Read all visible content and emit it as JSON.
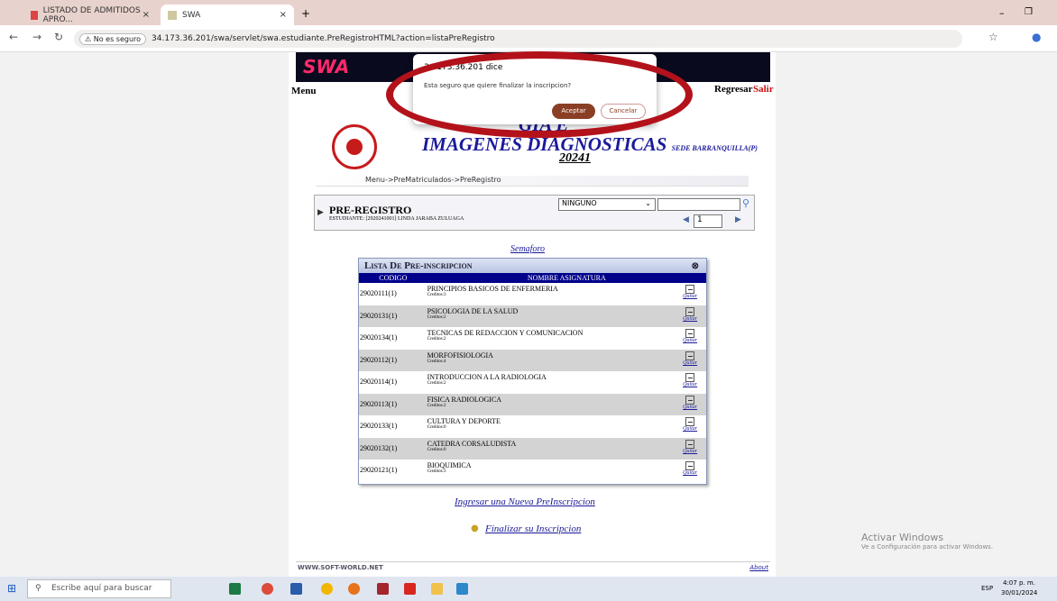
{
  "browser": {
    "tabs": [
      {
        "label": "LISTADO DE ADMITIDOS APRO...",
        "close": "×"
      },
      {
        "label": "SWA",
        "close": "×"
      }
    ],
    "new_tab": "+",
    "security_badge": "No es seguro",
    "url": "34.173.36.201/swa/servlet/swa.estudiante.PreRegistroHTML?action=listaPreRegistro",
    "window_controls": [
      "–",
      "❐"
    ]
  },
  "page": {
    "menu_label": "Menu",
    "regresar": "Regresar",
    "salir": "Salir",
    "title_line1": "GÍA E",
    "title_line2": "IMAGENES DIAGNOSTICAS",
    "sede": "SEDE BARRANQUILLA(P)",
    "period": "20241",
    "breadcrumb": "Menu->PreMatriculados->PreRegistro",
    "prereg_title": "PRE-REGISTRO",
    "student": "ESTUDIANTE: [2920241001] LINDA JARABA ZULUAGA",
    "filter_value": "NINGUNO",
    "page_number": "1",
    "semaforo": "Semaforo",
    "list_title": "Lista De Pre-inscripcion",
    "col_code": "CODIGO",
    "col_name": "NOMBRE ASIGNATURA",
    "rows": [
      {
        "code": "29020111(1)",
        "name": "PRINCIPIOS BASICOS DE ENFERMERIA",
        "credits": "Creditos:3",
        "action": "Quitar"
      },
      {
        "code": "29020131(1)",
        "name": "PSICOLOGIA DE LA SALUD",
        "credits": "Creditos:2",
        "action": "Quitar"
      },
      {
        "code": "29020134(1)",
        "name": "TECNICAS DE REDACCION Y COMUNICACION",
        "credits": "Creditos:2",
        "action": "Quitar"
      },
      {
        "code": "29020112(1)",
        "name": "MORFOFISIOLOGIA",
        "credits": "Creditos:4",
        "action": "Quitar"
      },
      {
        "code": "29020114(1)",
        "name": "INTRODUCCION A LA RADIOLOGIA",
        "credits": "Creditos:2",
        "action": "Quitar"
      },
      {
        "code": "29020113(1)",
        "name": "FISICA RADIOLOGICA",
        "credits": "Creditos:2",
        "action": "Quitar"
      },
      {
        "code": "29020133(1)",
        "name": "CULTURA Y DEPORTE",
        "credits": "Creditos:0",
        "action": "Quitar"
      },
      {
        "code": "29020132(1)",
        "name": "CATEDRA CORSALUDISTA",
        "credits": "Creditos:0",
        "action": "Quitar"
      },
      {
        "code": "29020121(1)",
        "name": "BIOQUIMICA",
        "credits": "Creditos:3",
        "action": "Quitar"
      }
    ],
    "new_prereg": "Ingresar una Nueva PreInscripcion",
    "finalize": "Finalizar su Inscripcion",
    "footer_left": "WWW.SOFT-WORLD.NET",
    "footer_right": "About"
  },
  "dialog": {
    "title": "34.173.36.201 dice",
    "message": "Esta seguro que quiere finalizar la inscripcion?",
    "ok": "Aceptar",
    "cancel": "Cancelar"
  },
  "watermark": {
    "title": "Activar Windows",
    "subtitle": "Ve a Configuración para activar Windows."
  },
  "taskbar": {
    "search_placeholder": "Escribe aquí para buscar",
    "time": "4:07 p. m.",
    "date": "30/01/2024",
    "lang": "ESP"
  },
  "colors": {
    "accent": "#8a3f24",
    "highlight_ring": "#b3121b",
    "header_blue": "#00008b"
  }
}
